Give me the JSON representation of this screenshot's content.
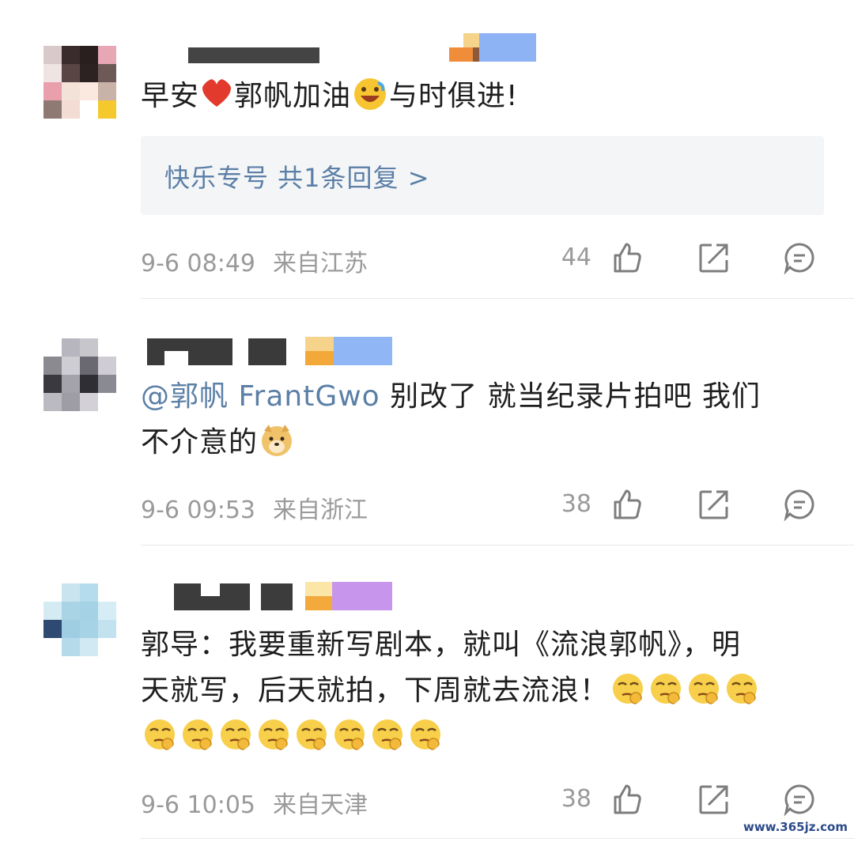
{
  "comments": [
    {
      "text_parts": [
        "早安",
        "郭帆加油",
        "与时俱进!"
      ],
      "reply_label": "快乐专号 共1条回复 >",
      "date": "9-6 08:49",
      "location": "来自江苏",
      "likes": "44"
    },
    {
      "mention": "@郭帆 FrantGwo",
      "text_line1": " 别改了 就当纪录片拍吧 我们",
      "text_line2": "不介意的",
      "date": "9-6 09:53",
      "location": "来自浙江",
      "likes": "38"
    },
    {
      "text_line1": "郭导：我要重新写剧本，就叫《流浪郭帆》，明",
      "text_line2": "天就写，后天就拍，下周就去流浪！",
      "date": "9-6 10:05",
      "location": "来自天津",
      "likes": "38"
    }
  ],
  "icons": {
    "like": "thumbs-up-icon",
    "share": "share-icon",
    "comment": "comment-icon"
  },
  "colors": {
    "mention": "#5b7fa6",
    "meta": "#9a9a9a",
    "reply_bg": "#f4f5f7"
  },
  "watermark": "www.365jz.com"
}
